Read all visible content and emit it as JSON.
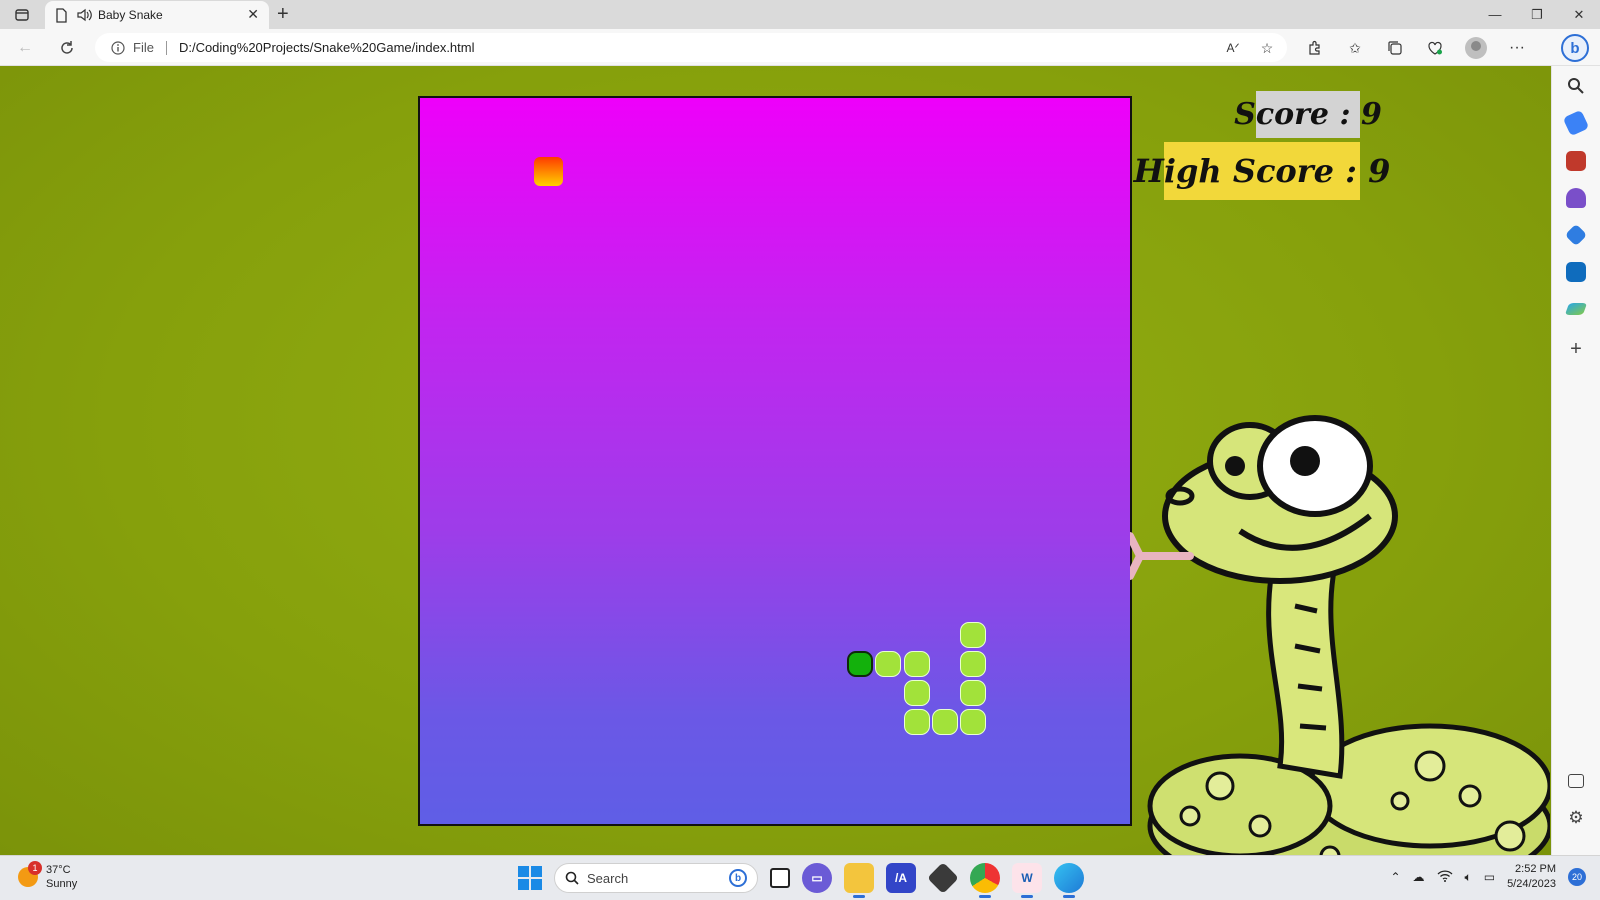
{
  "browser": {
    "tab_title": "Baby Snake",
    "url_scheme_label": "File",
    "url": "D:/Coding%20Projects/Snake%20Game/index.html"
  },
  "game": {
    "score_text": "Score : 9",
    "high_score_text": "High Score : 9",
    "score": 9,
    "high_score": 9,
    "colors": {
      "background": "#8aa40e",
      "board_top": "#ee00fa",
      "board_bottom": "#5f5ee6",
      "snake_head": "#13b10c",
      "snake_body": "#a2e23a",
      "food_top": "#ff3b00",
      "food_bottom": "#ffd000",
      "score_bg": "#d3d3d3",
      "high_score_bg": "#f2d83a"
    },
    "grid_size": 25,
    "food": {
      "col": 5,
      "row": 3
    },
    "snake": [
      {
        "col": 16,
        "row": 20,
        "head": true
      },
      {
        "col": 17,
        "row": 20
      },
      {
        "col": 18,
        "row": 20
      },
      {
        "col": 18,
        "row": 21
      },
      {
        "col": 18,
        "row": 22
      },
      {
        "col": 19,
        "row": 22
      },
      {
        "col": 20,
        "row": 22
      },
      {
        "col": 20,
        "row": 21
      },
      {
        "col": 20,
        "row": 20
      },
      {
        "col": 20,
        "row": 19
      }
    ]
  },
  "sidebar": {
    "icons": [
      "search-icon",
      "shopping-tag-icon",
      "toolbox-icon",
      "games-icon",
      "office-icon",
      "outlook-icon",
      "send-icon",
      "add-icon",
      "split-screen-icon",
      "settings-icon"
    ]
  },
  "taskbar": {
    "weather_badge": "1",
    "temperature": "37°C",
    "condition": "Sunny",
    "search_placeholder": "Search",
    "time": "2:52 PM",
    "date": "5/24/2023",
    "notification_count": "20"
  }
}
